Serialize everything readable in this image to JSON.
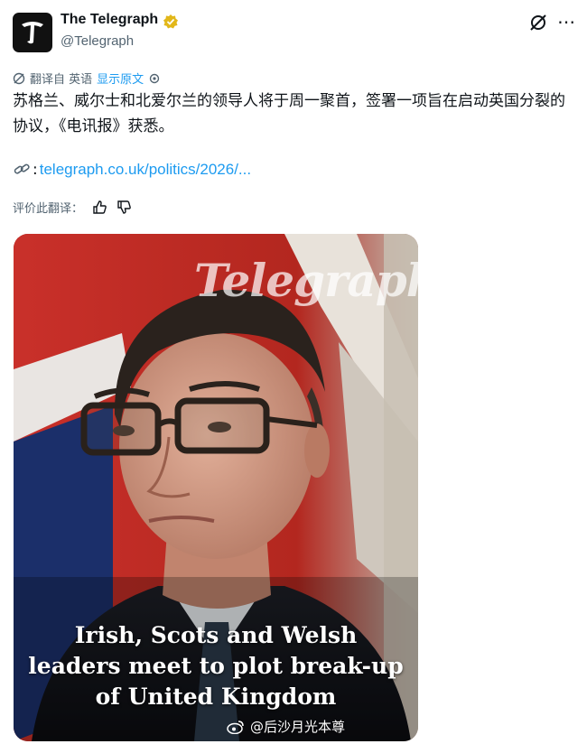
{
  "account": {
    "name": "The Telegraph",
    "handle": "@Telegraph",
    "avatar_glyph": "T"
  },
  "translation": {
    "label": "翻译自 英语",
    "show_original": "显示原文"
  },
  "post": {
    "text": "苏格兰、威尔士和北爱尔兰的领导人将于周一聚首，签署一项旨在启动英国分裂的协议，《电讯报》获悉。",
    "link_prefix": ":",
    "link": "telegraph.co.uk/politics/2026/..."
  },
  "rate": {
    "label": "评价此翻译："
  },
  "media": {
    "logo_watermark": "Telegraph",
    "headline_lines": [
      "Irish, Scots and Welsh",
      "leaders meet to plot break-up",
      "of United Kingdom"
    ],
    "source_watermark": "@后沙月光本尊"
  },
  "colors": {
    "accent": "#1d9bf0",
    "muted": "#536471",
    "verified": "#e2b719"
  },
  "icons": [
    "verified-badge-icon",
    "grok-icon",
    "more-icon",
    "translate-icon",
    "settings-icon",
    "link-icon",
    "thumbs-up-icon",
    "thumbs-down-icon",
    "weibo-icon"
  ]
}
